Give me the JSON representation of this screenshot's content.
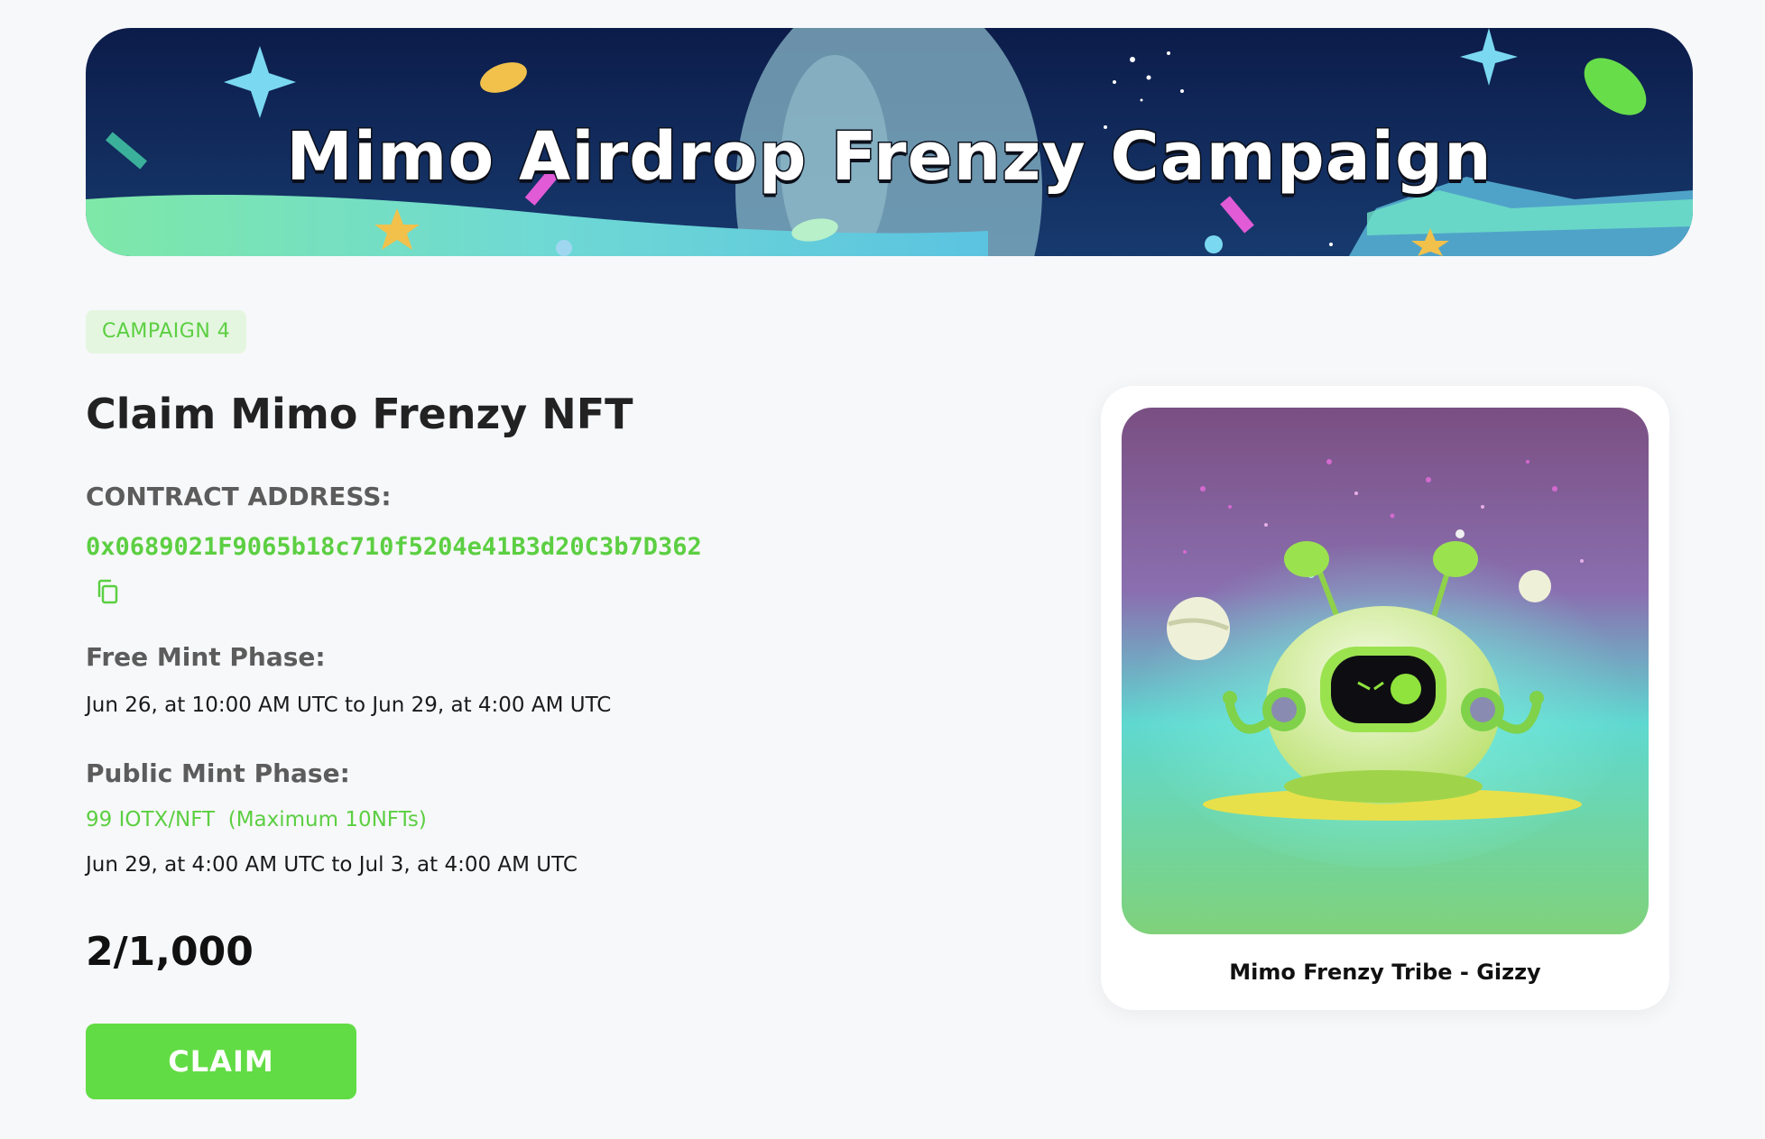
{
  "banner": {
    "title": "Mimo Airdrop Frenzy Campaign"
  },
  "campaign": {
    "badge": "CAMPAIGN 4",
    "title": "Claim Mimo Frenzy NFT",
    "contract_label": "CONTRACT ADDRESS:",
    "contract_address": "0x0689021F9065b18c710f5204e41B3d20C3b7D362",
    "free_mint_label": "Free Mint Phase:",
    "free_mint_dates": "Jun 26, at 10:00 AM UTC to Jun 29, at 4:00 AM UTC",
    "public_mint_label": "Public Mint Phase:",
    "public_mint_price": "99 IOTX/NFT  (Maximum 10NFTs)",
    "public_mint_dates": "Jun 29, at 4:00 AM UTC to Jul 3, at 4:00 AM UTC",
    "minted_count": "2/1,000",
    "claim_label": "CLAIM"
  },
  "nft": {
    "name": "Mimo Frenzy Tribe - Gizzy"
  },
  "icons": {
    "copy": "copy-icon"
  },
  "colors": {
    "accent_green": "#5ccf42",
    "button_green": "#62dc45",
    "badge_bg": "#e4f6e0",
    "banner_navy": "#0d1f4d"
  }
}
